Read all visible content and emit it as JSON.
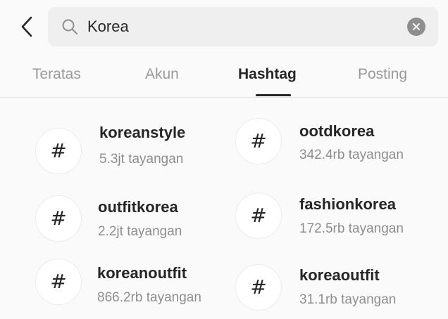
{
  "search": {
    "value": "Korea"
  },
  "tabs": [
    {
      "label": "Teratas"
    },
    {
      "label": "Akun"
    },
    {
      "label": "Hashtag"
    },
    {
      "label": "Posting"
    }
  ],
  "active_tab": "Hashtag",
  "hash_symbol": "#",
  "results": [
    {
      "name": "koreanstyle",
      "count": "5.3jt tayangan"
    },
    {
      "name": "ootdkorea",
      "count": "342.4rb tayangan"
    },
    {
      "name": "outfitkorea",
      "count": "2.2jt tayangan"
    },
    {
      "name": "fashionkorea",
      "count": "172.5rb tayangan"
    },
    {
      "name": "koreanoutfit",
      "count": "866.2rb tayangan"
    },
    {
      "name": "koreaoutfit",
      "count": "31.1rb tayangan"
    }
  ],
  "icons": {
    "back": "chevron-left-icon",
    "search": "search-icon",
    "clear": "clear-x-icon",
    "hashtag": "hashtag-icon"
  },
  "colors": {
    "background": "#fafafa",
    "search_bg": "#efefef",
    "text_primary": "#262626",
    "text_secondary": "#8e8e8e",
    "tab_inactive": "#9a9a9a"
  }
}
